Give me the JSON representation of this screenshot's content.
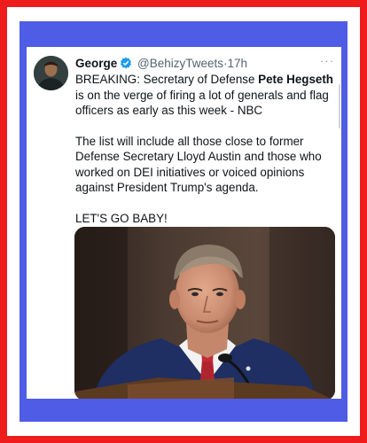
{
  "tweet": {
    "author_name": "George",
    "handle": "@BehizyTweets",
    "separator": "·",
    "time": "17h",
    "more": "···",
    "line1_pre": "BREAKING: Secretary of Defense ",
    "line1_bold": "Pete Hegseth",
    "line1_post": " is on the verge of firing a lot of generals and flag officers as early as this week - NBC",
    "paragraph2": "The list will include all those close to former Defense Secretary Lloyd Austin and those who worked on DEI initiatives or voiced opinions against President Trump's agenda.",
    "paragraph3": "LET'S GO BABY!"
  },
  "icons": {
    "verified": "verified-badge-icon",
    "more": "more-options-icon"
  },
  "colors": {
    "outer_border": "#ee1c1c",
    "inner_border": "#4f5ce6",
    "verified_blue": "#1d9bf0"
  }
}
